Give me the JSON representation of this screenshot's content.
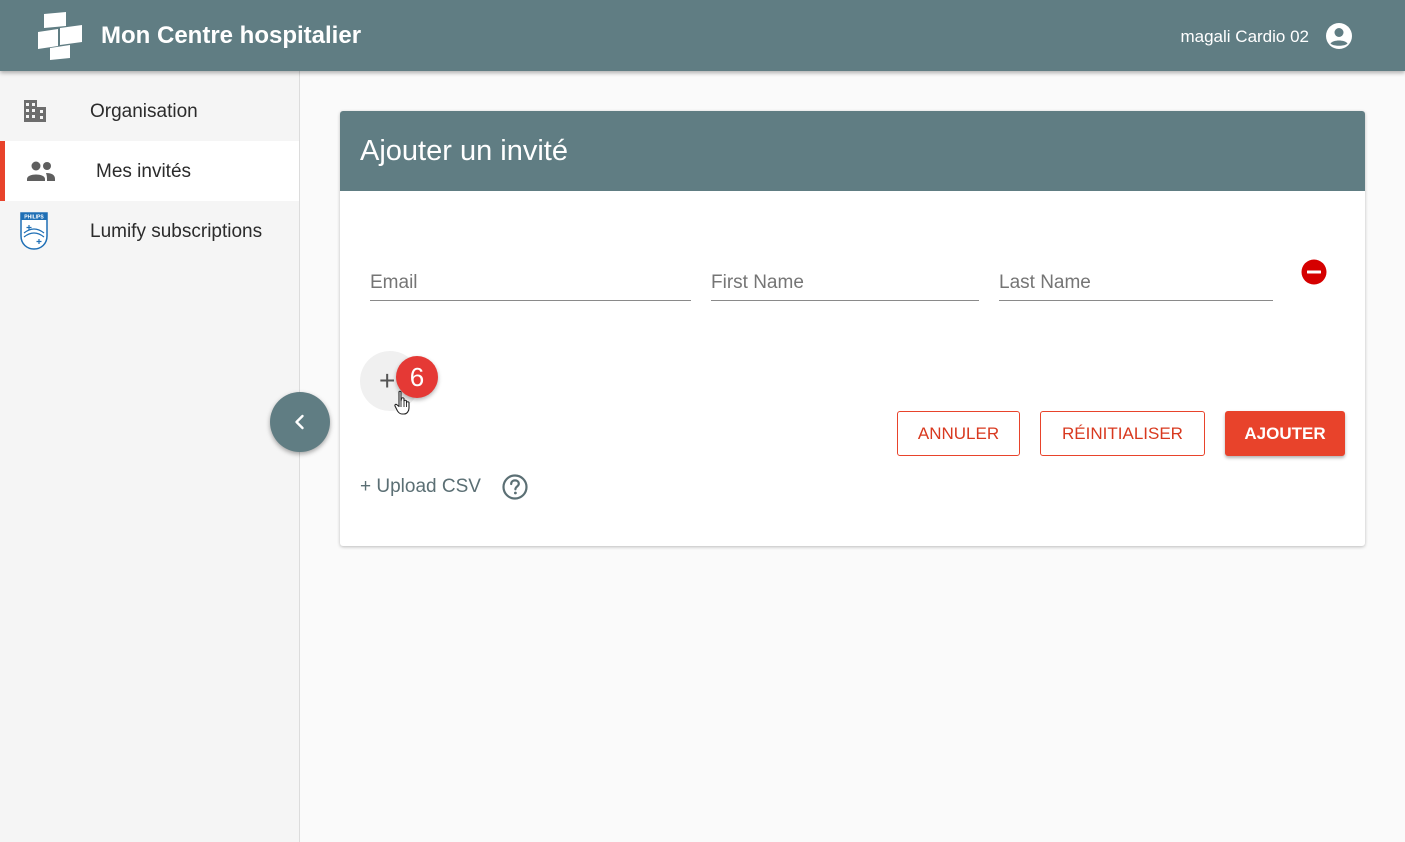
{
  "header": {
    "app_title": "Mon Centre hospitalier",
    "user_name": "magali Cardio 02",
    "logo_icon": "hospital-logo-icon",
    "user_icon": "account-circle-icon"
  },
  "sidebar": {
    "items": [
      {
        "label": "Organisation",
        "icon": "building-icon",
        "active": false
      },
      {
        "label": "Mes invités",
        "icon": "people-icon",
        "active": true
      },
      {
        "label": "Lumify subscriptions",
        "icon": "philips-shield-icon",
        "active": false
      }
    ],
    "philips_text": "PHILIPS",
    "collapse_icon": "chevron-left-icon"
  },
  "card": {
    "title": "Ajouter un invité",
    "fields": {
      "email_placeholder": "Email",
      "first_name_placeholder": "First Name",
      "last_name_placeholder": "Last Name",
      "email_value": "",
      "first_name_value": "",
      "last_name_value": ""
    },
    "add_row_symbol": "+",
    "step_badge": "6",
    "buttons": {
      "cancel": "ANNULER",
      "reset": "RÉINITIALISER",
      "submit": "AJOUTER"
    },
    "upload_csv": "+ Upload CSV"
  },
  "colors": {
    "header": "#607d83",
    "accent": "#e8432b",
    "badge": "#e53935",
    "remove": "#d50000"
  }
}
